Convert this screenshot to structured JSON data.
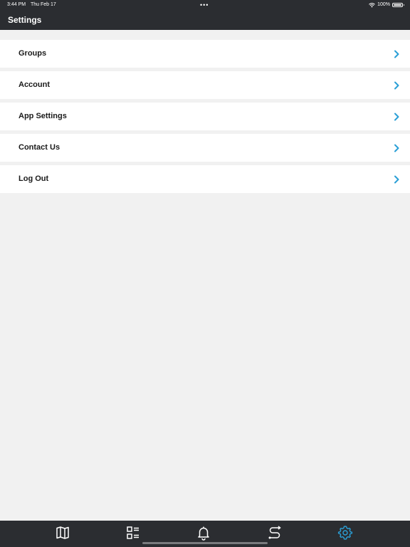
{
  "status_bar": {
    "time": "3:44 PM",
    "date": "Thu Feb 17",
    "dots": "•••",
    "battery_percent": "100%",
    "icons": [
      "wifi-icon",
      "battery-icon"
    ]
  },
  "header": {
    "title": "Settings"
  },
  "settings": {
    "items": [
      {
        "label": "Groups",
        "icon": "chevron-right-icon"
      },
      {
        "label": "Account",
        "icon": "chevron-right-icon"
      },
      {
        "label": "App Settings",
        "icon": "chevron-right-icon"
      },
      {
        "label": "Contact Us",
        "icon": "chevron-right-icon"
      },
      {
        "label": "Log Out",
        "icon": "chevron-right-icon"
      }
    ]
  },
  "tab_bar": {
    "tabs": [
      {
        "icon": "map-icon",
        "active": false
      },
      {
        "icon": "checklist-icon",
        "active": false
      },
      {
        "icon": "bell-icon",
        "active": false
      },
      {
        "icon": "route-icon",
        "active": false
      },
      {
        "icon": "gear-icon",
        "active": true
      }
    ]
  },
  "colors": {
    "header_bg": "#2b2d31",
    "page_bg": "#f1f1f1",
    "accent": "#2a9fd6",
    "tab_inactive": "#ffffff"
  }
}
